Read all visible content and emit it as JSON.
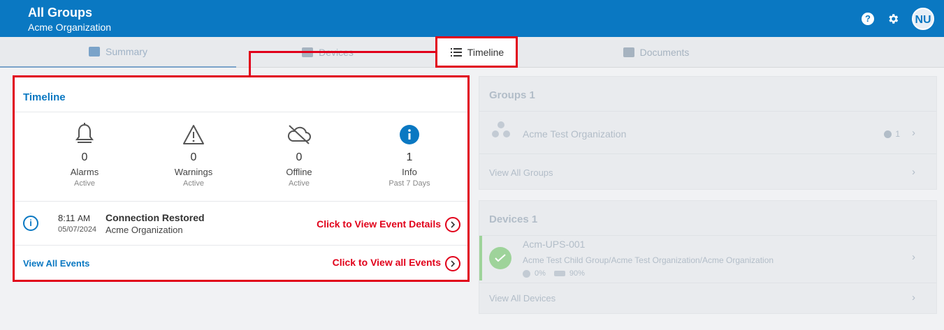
{
  "header": {
    "title": "All Groups",
    "subtitle": "Acme Organization",
    "avatar": "NU",
    "help": "?"
  },
  "tabs": [
    {
      "label": "Summary"
    },
    {
      "label": "Devices"
    },
    {
      "label": "Timeline"
    },
    {
      "label": "Documents"
    }
  ],
  "timeline": {
    "title": "Timeline",
    "stats": [
      {
        "count": "0",
        "label": "Alarms",
        "sub": "Active",
        "icon": "bell-icon"
      },
      {
        "count": "0",
        "label": "Warnings",
        "sub": "Active",
        "icon": "warning-icon"
      },
      {
        "count": "0",
        "label": "Offline",
        "sub": "Active",
        "icon": "cloud-off-icon"
      },
      {
        "count": "1",
        "label": "Info",
        "sub": "Past 7 Days",
        "icon": "info-icon"
      }
    ],
    "event": {
      "time": "8:11",
      "ampm": "AM",
      "date": "05/07/2024",
      "title": "Connection Restored",
      "org": "Acme Organization"
    },
    "view_all": "View All Events",
    "callout_event": "Click to View Event Details",
    "callout_all": "Click to View all Events"
  },
  "groups": {
    "title": "Groups 1",
    "item": {
      "name": "Acme Test Organization",
      "info_count": "1"
    },
    "view_all": "View All Groups"
  },
  "devices": {
    "title": "Devices 1",
    "item": {
      "name": "Acm-UPS-001",
      "path": "Acme Test Child Group/Acme Test Organization/Acme Organization",
      "load": "0%",
      "battery": "90%"
    },
    "view_all": "View All Devices"
  },
  "colors": {
    "brand": "#0a78c2",
    "callout": "#e1001a",
    "ok": "#9ed39a"
  }
}
